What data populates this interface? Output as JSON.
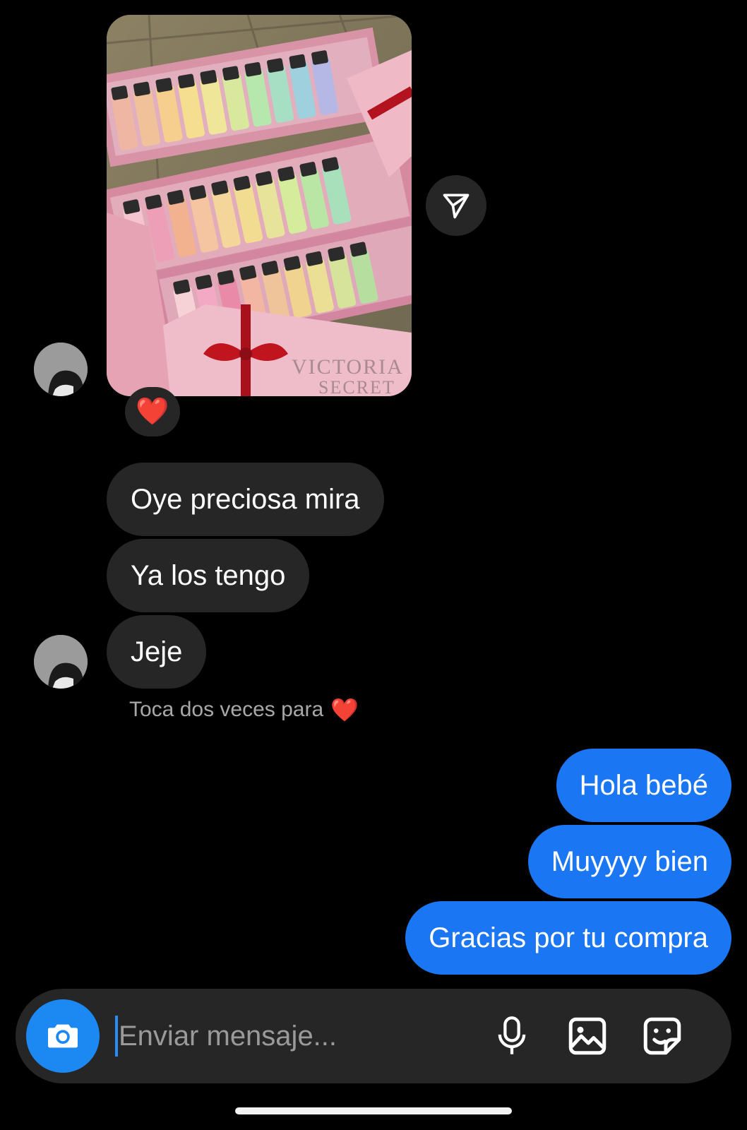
{
  "shared_post": {
    "image_alt": "Victoria's Secret mist gift sets",
    "watermark_text": "VICTORIA SECRET",
    "reaction": "❤️"
  },
  "messages_received": [
    {
      "text": "Oye preciosa mira"
    },
    {
      "text": "Ya los tengo"
    },
    {
      "text": "Jeje"
    }
  ],
  "hint": {
    "text": "Toca dos veces para",
    "emoji": "❤️"
  },
  "messages_sent": [
    {
      "text": "Hola bebé"
    },
    {
      "text": "Muyyyy bien"
    },
    {
      "text": "Gracias por tu compra"
    }
  ],
  "composer": {
    "placeholder": "Enviar mensaje...",
    "icons": [
      "camera-icon",
      "microphone-icon",
      "gallery-icon",
      "sticker-icon"
    ]
  },
  "colors": {
    "background": "#000000",
    "incoming_bubble": "#262626",
    "outgoing_bubble": "#1a76f2",
    "camera_button": "#1c88f2"
  }
}
